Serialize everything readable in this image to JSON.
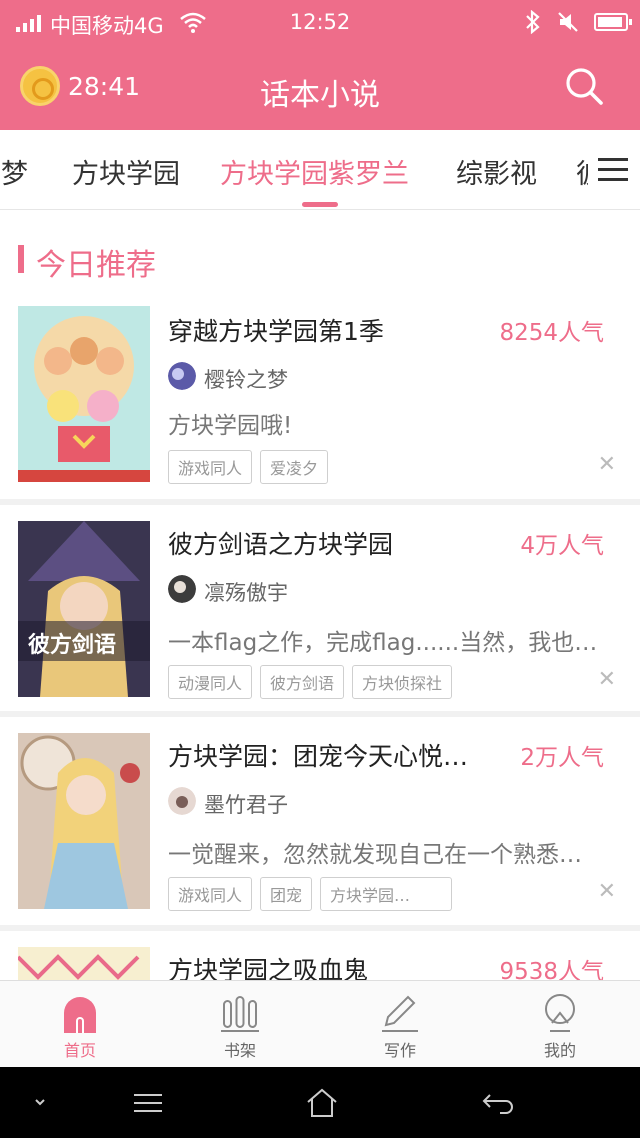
{
  "status_bar": {
    "carrier": "中国移动4G",
    "time": "12:52"
  },
  "header": {
    "timer": "28:41",
    "title": "话本小说"
  },
  "tabs": [
    {
      "label": "间梦"
    },
    {
      "label": "方块学园"
    },
    {
      "label": "方块学园紫罗兰"
    },
    {
      "label": "综影视"
    },
    {
      "label": "彼"
    }
  ],
  "section": {
    "title": "今日推荐"
  },
  "books": [
    {
      "title": "穿越方块学园第1季",
      "popularity": "8254人气",
      "author": "樱铃之梦",
      "description": "方块学园哦!",
      "tags": [
        "游戏同人",
        "爱凌夕"
      ]
    },
    {
      "title": "彼方剑语之方块学园",
      "popularity": "4万人气",
      "author": "凛殇傲宇",
      "description": "一本flag之作，完成flag......当然，我也…",
      "tags": [
        "动漫同人",
        "彼方剑语",
        "方块侦探社"
      ],
      "cover_text": "彼方剑语"
    },
    {
      "title": "方块学园：团宠今天心悦…",
      "popularity": "2万人气",
      "author": "墨竹君子",
      "description": "一觉醒来，忽然就发现自己在一个熟悉…",
      "tags": [
        "游戏同人",
        "团宠",
        "方块学园…"
      ]
    },
    {
      "title": "方块学园之吸血鬼",
      "popularity": "9538人气"
    }
  ],
  "bottom_nav": [
    {
      "label": "首页"
    },
    {
      "label": "书架"
    },
    {
      "label": "写作"
    },
    {
      "label": "我的"
    }
  ],
  "close_glyph": "✕",
  "colors": {
    "accent": "#ee6d8a"
  }
}
